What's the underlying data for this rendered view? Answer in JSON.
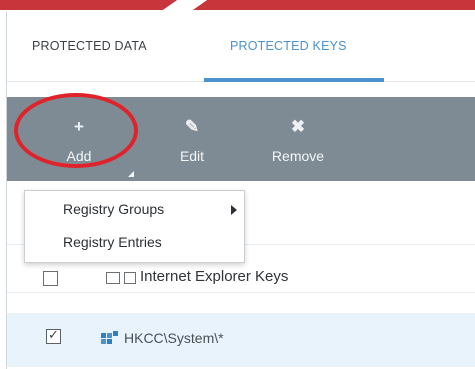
{
  "tabs": [
    {
      "label": "PROTECTED DATA"
    },
    {
      "label": "PROTECTED KEYS"
    }
  ],
  "toolbar": {
    "add": {
      "label": "Add",
      "icon": "plus-icon"
    },
    "edit": {
      "label": "Edit",
      "icon": "pencil-icon"
    },
    "remove": {
      "label": "Remove",
      "icon": "x-icon"
    }
  },
  "add_menu": {
    "items": [
      {
        "label": "Registry Groups",
        "has_submenu": true
      },
      {
        "label": "Registry Entries",
        "has_submenu": false
      }
    ]
  },
  "rows": [
    {
      "label": "Internet Explorer Keys",
      "checked": false
    },
    {
      "label": "HKCC\\System\\*",
      "checked": true
    }
  ],
  "colors": {
    "accent": "#4a93cf",
    "toolbar": "#7e8b95",
    "highlight": "#e0232a",
    "banner": "#c8363b",
    "selected_row": "#e9f3fb"
  }
}
